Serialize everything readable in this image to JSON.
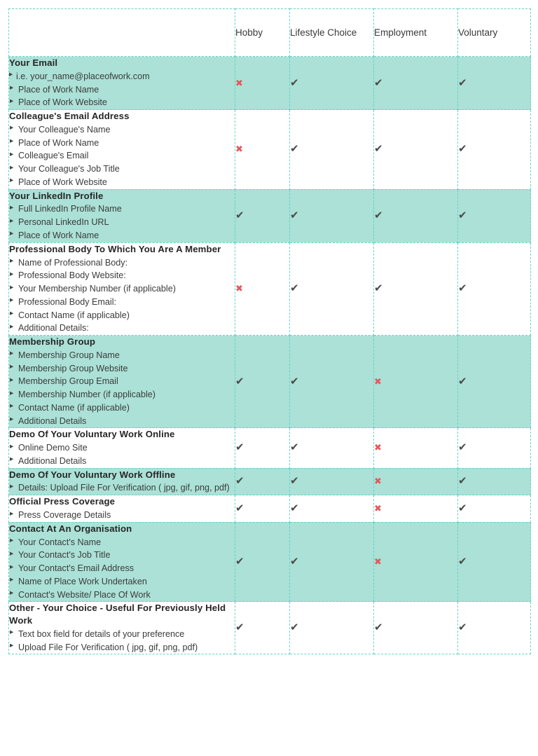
{
  "table": {
    "columns": [
      {
        "key": "desc",
        "label": ""
      },
      {
        "key": "hobby",
        "label": "Hobby"
      },
      {
        "key": "lifestyle",
        "label": "Lifestyle Choice"
      },
      {
        "key": "employment",
        "label": "Employment"
      },
      {
        "key": "voluntary",
        "label": "Voluntary"
      }
    ],
    "symbols": {
      "tick": "✔",
      "cross": "✖",
      "tick_name": "check-mark-icon",
      "cross_name": "cross-mark-icon"
    },
    "colors": {
      "tint": "#abe1d7",
      "border": "#67d2cb",
      "tick": "#4a4a4a",
      "cross": "#e2595c",
      "text": "#333333"
    },
    "rows": [
      {
        "tinted": true,
        "title": "Your Email",
        "items": [
          "i.e. your_name@placeofwork.com",
          "Place of Work Name",
          "Place of Work Website"
        ],
        "marks": [
          "cross",
          "tick",
          "tick",
          "tick"
        ]
      },
      {
        "tinted": false,
        "title": "Colleague's Email Address",
        "items": [
          "Your Colleague's Name",
          "Place of Work Name",
          "Colleague's Email",
          "Your Colleague's Job Title",
          "Place of Work Website"
        ],
        "marks": [
          "cross",
          "tick",
          "tick",
          "tick"
        ]
      },
      {
        "tinted": true,
        "title": "Your LinkedIn Profile",
        "items": [
          "Full LinkedIn Profile Name",
          "Personal LinkedIn URL",
          "Place of Work Name"
        ],
        "marks": [
          "tick",
          "tick",
          "tick",
          "tick"
        ]
      },
      {
        "tinted": false,
        "title": "Professional Body To Which You Are A Member",
        "items": [
          "Name of Professional Body:",
          "Professional Body Website:",
          "Your Membership Number (if applicable)",
          "Professional Body Email:",
          "Contact Name (if applicable)",
          "Additional Details:"
        ],
        "marks": [
          "cross",
          "tick",
          "tick",
          "tick"
        ]
      },
      {
        "tinted": true,
        "title": "Membership Group",
        "items": [
          "Membership Group Name",
          "Membership Group Website",
          "Membership Group Email",
          "Membership Number (if applicable)",
          "Contact Name (if applicable)",
          "Additional Details"
        ],
        "marks": [
          "tick",
          "tick",
          "cross",
          "tick"
        ]
      },
      {
        "tinted": false,
        "title": "Demo Of Your Voluntary Work Online",
        "items": [
          "Online Demo Site",
          "Additional Details"
        ],
        "marks": [
          "tick",
          "tick",
          "cross",
          "tick"
        ]
      },
      {
        "tinted": true,
        "title": "Demo Of Your Voluntary Work Offline",
        "items": [
          "Details: Upload File For Verification ( jpg, gif, png, pdf)"
        ],
        "marks": [
          "tick",
          "tick",
          "cross",
          "tick"
        ]
      },
      {
        "tinted": false,
        "title": "Official Press Coverage",
        "items": [
          "Press Coverage Details"
        ],
        "marks": [
          "tick",
          "tick",
          "cross",
          "tick"
        ]
      },
      {
        "tinted": true,
        "title": "Contact At An Organisation",
        "items": [
          "Your Contact's Name",
          "Your Contact's Job Title",
          "Your Contact's Email Address",
          "Name of Place Work Undertaken",
          "Contact's Website/ Place Of Work"
        ],
        "marks": [
          "tick",
          "tick",
          "cross",
          "tick"
        ]
      },
      {
        "tinted": false,
        "title": "Other - Your Choice - Useful For Previously Held Work",
        "items": [
          "Text box field for details of your preference",
          "Upload File For Verification ( jpg, gif, png, pdf)"
        ],
        "marks": [
          "tick",
          "tick",
          "tick",
          "tick"
        ]
      }
    ]
  }
}
